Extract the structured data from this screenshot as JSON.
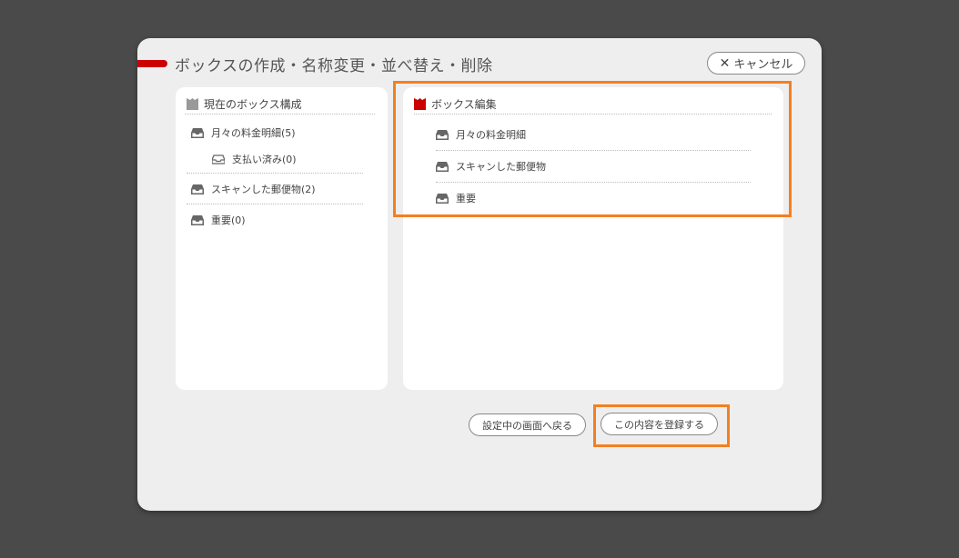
{
  "dialog": {
    "title": "ボックスの作成・名称変更・並べ替え・削除",
    "cancel_label": "キャンセル",
    "cancel_icon": "x-icon"
  },
  "current_boxes": {
    "heading": "現在のボックス構成",
    "icon": "box-icon",
    "items": [
      {
        "label": "月々の料金明細(5)",
        "level": 0
      },
      {
        "label": "支払い済み(0)",
        "level": 1
      },
      {
        "label": "スキャンした郵便物(2)",
        "level": 0
      },
      {
        "label": "重要(0)",
        "level": 0
      }
    ]
  },
  "box_edit": {
    "heading": "ボックス編集",
    "icon": "box-icon",
    "icon_color": "#cc0000",
    "items": [
      {
        "label": "月々の料金明細"
      },
      {
        "label": "スキャンした郵便物"
      },
      {
        "label": "重要"
      }
    ]
  },
  "footer": {
    "back_label": "設定中の画面へ戻る",
    "register_label": "この内容を登録する"
  },
  "colors": {
    "accent": "#cc0000",
    "highlight": "#f47f20",
    "backdrop": "#4a4a4a"
  }
}
